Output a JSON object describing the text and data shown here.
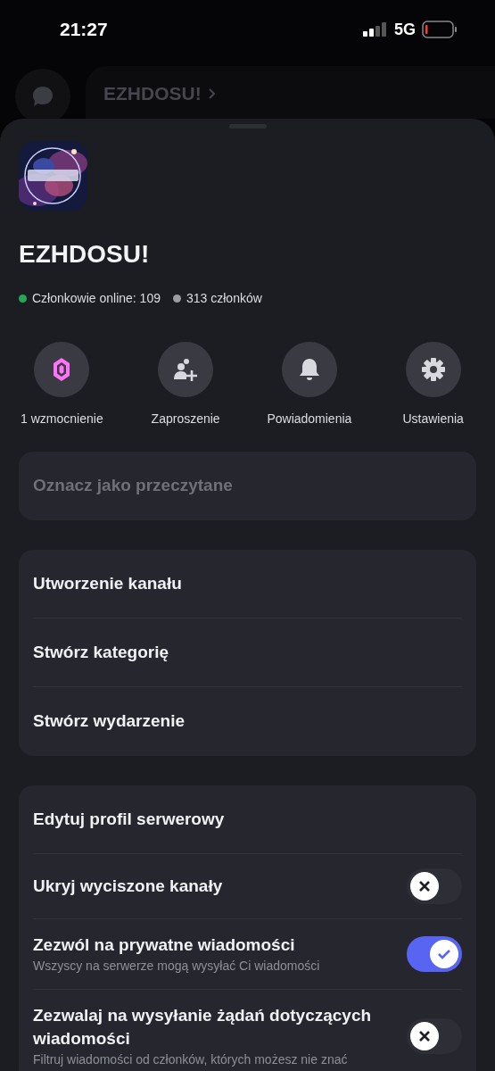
{
  "status_bar": {
    "time": "21:27",
    "network": "5G"
  },
  "background": {
    "server_title": "EZHDOSU!"
  },
  "server": {
    "name": "EZHDOSU!",
    "stats": [
      {
        "text": "Członkowie online: 109",
        "color": "#23a55a"
      },
      {
        "text": "313 członków",
        "color": "#9a9ba3"
      }
    ]
  },
  "actions": [
    {
      "kind": "boost",
      "label": "1 wzmocnienie"
    },
    {
      "kind": "invite",
      "label": "Zaproszenie"
    },
    {
      "kind": "notifications",
      "label": "Powiadomienia"
    },
    {
      "kind": "settings",
      "label": "Ustawienia"
    }
  ],
  "groups": [
    [
      {
        "label": "Oznacz jako przeczytane",
        "disabled": true
      }
    ],
    [
      {
        "label": "Utworzenie kanału",
        "disabled": false
      },
      {
        "label": "Stwórz kategorię",
        "disabled": false
      },
      {
        "label": "Stwórz wydarzenie",
        "disabled": false
      }
    ],
    [
      {
        "kind": "link",
        "label": "Edytuj profil serwerowy"
      },
      {
        "kind": "toggle",
        "label": "Ukryj wyciszone kanały",
        "on": false
      },
      {
        "kind": "toggle",
        "label": "Zezwól na prywatne wiadomości",
        "description": "Wszyscy na serwerze mogą wysyłać Ci wiadomości",
        "on": true
      },
      {
        "kind": "toggle",
        "label": "Zezwalaj na wysyłanie żądań dotyczących wiadomości",
        "description": "Filtruj wiadomości od członków, których możesz nie znać",
        "on": false
      }
    ]
  ]
}
